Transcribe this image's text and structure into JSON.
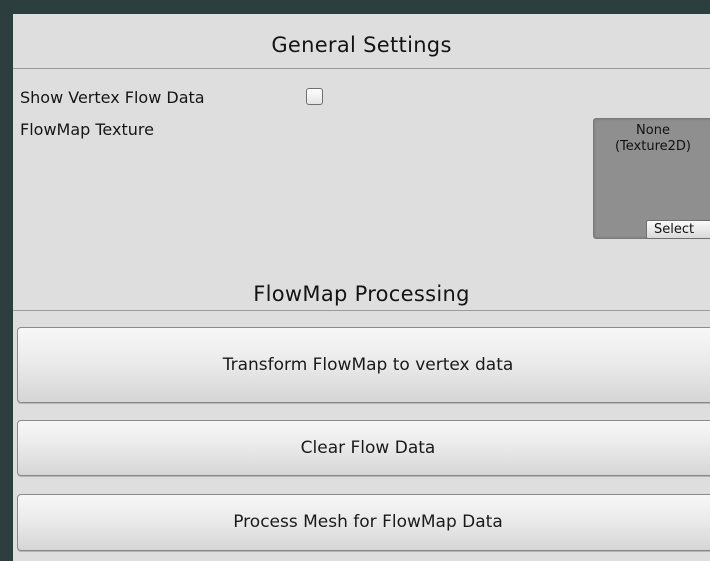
{
  "general_settings": {
    "title": "General Settings",
    "show_vertex_flow_label": "Show Vertex Flow Data",
    "show_vertex_flow_checked": false,
    "flowmap_texture_label": "FlowMap Texture",
    "texture_slot": {
      "value_line1": "None",
      "value_line2": "(Texture2D)",
      "select_label": "Select"
    }
  },
  "flowmap_processing": {
    "title": "FlowMap Processing",
    "buttons": [
      {
        "label": "Transform FlowMap to vertex data"
      },
      {
        "label": "Clear Flow Data"
      },
      {
        "label": "Process Mesh for FlowMap Data"
      }
    ]
  }
}
